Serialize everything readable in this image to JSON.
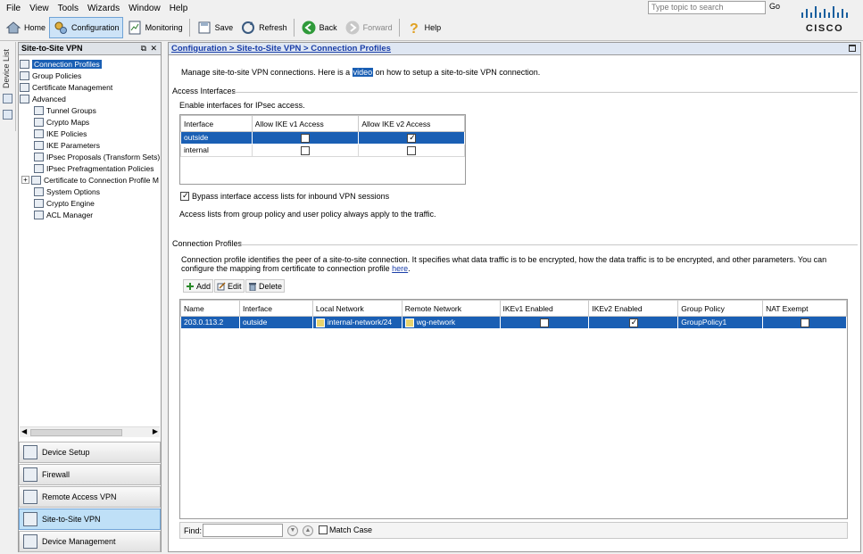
{
  "menu": [
    "File",
    "View",
    "Tools",
    "Wizards",
    "Window",
    "Help"
  ],
  "help_search": {
    "placeholder": "Type topic to search",
    "go_label": "Go"
  },
  "brand": "CISCO",
  "toolbar": {
    "home": "Home",
    "configuration": "Configuration",
    "monitoring": "Monitoring",
    "save": "Save",
    "refresh": "Refresh",
    "back": "Back",
    "forward": "Forward",
    "help": "Help"
  },
  "device_list_tab": "Device List",
  "left_panel": {
    "title": "Site-to-Site VPN",
    "tree": [
      {
        "label": "Connection Profiles",
        "level": 0,
        "selected": true
      },
      {
        "label": "Group Policies",
        "level": 0
      },
      {
        "label": "Certificate Management",
        "level": 0
      },
      {
        "label": "Advanced",
        "level": 0
      },
      {
        "label": "Tunnel Groups",
        "level": 1
      },
      {
        "label": "Crypto Maps",
        "level": 1
      },
      {
        "label": "IKE Policies",
        "level": 1
      },
      {
        "label": "IKE Parameters",
        "level": 1
      },
      {
        "label": "IPsec Proposals (Transform Sets)",
        "level": 1
      },
      {
        "label": "IPsec Prefragmentation Policies",
        "level": 1
      },
      {
        "label": "Certificate to Connection Profile M",
        "level": 1
      },
      {
        "label": "System Options",
        "level": 1
      },
      {
        "label": "Crypto Engine",
        "level": 1
      },
      {
        "label": "ACL Manager",
        "level": 1
      }
    ],
    "nav_buttons": [
      {
        "label": "Device Setup"
      },
      {
        "label": "Firewall"
      },
      {
        "label": "Remote Access VPN"
      },
      {
        "label": "Site-to-Site VPN",
        "active": true
      },
      {
        "label": "Device Management"
      }
    ]
  },
  "main": {
    "breadcrumb": "Configuration > Site-to-Site VPN > Connection Profiles",
    "intro_before": "Manage site-to-site VPN connections. Here is a",
    "intro_link": "video",
    "intro_after": "on how to setup a site-to-site VPN connection.",
    "access_interfaces": {
      "section_title": "Access Interfaces",
      "subtitle": "Enable interfaces for IPsec access.",
      "columns": [
        "Interface",
        "Allow IKE v1 Access",
        "Allow IKE v2 Access"
      ],
      "rows": [
        {
          "interface": "outside",
          "ikev1": false,
          "ikev2": true,
          "selected": true
        },
        {
          "interface": "internal",
          "ikev1": false,
          "ikev2": false
        }
      ],
      "bypass_label": "Bypass interface access lists for inbound VPN sessions",
      "bypass_checked": true,
      "note": "Access lists from group policy and user policy always apply to the traffic."
    },
    "connection_profiles": {
      "section_title": "Connection Profiles",
      "desc_line1": "Connection profile identifies the peer of a site-to-site connection. It specifies what data traffic is to be encrypted, how the data traffic is to be encrypted, and other parameters. You can",
      "desc_line2_before": "configure the mapping from certificate to connection profile",
      "desc_line2_link": "here",
      "desc_line2_after": ".",
      "actions": {
        "add": "Add",
        "edit": "Edit",
        "delete": "Delete"
      },
      "columns": [
        "Name",
        "Interface",
        "Local Network",
        "Remote Network",
        "IKEv1 Enabled",
        "IKEv2 Enabled",
        "Group Policy",
        "NAT Exempt"
      ],
      "rows": [
        {
          "name": "203.0.113.2",
          "interface": "outside",
          "local_network": "internal-network/24",
          "remote_network": "wg-network",
          "ikev1": false,
          "ikev2": true,
          "group_policy": "GroupPolicy1",
          "nat_exempt": false
        }
      ]
    },
    "find": {
      "label": "Find:",
      "match_case": "Match Case"
    }
  }
}
